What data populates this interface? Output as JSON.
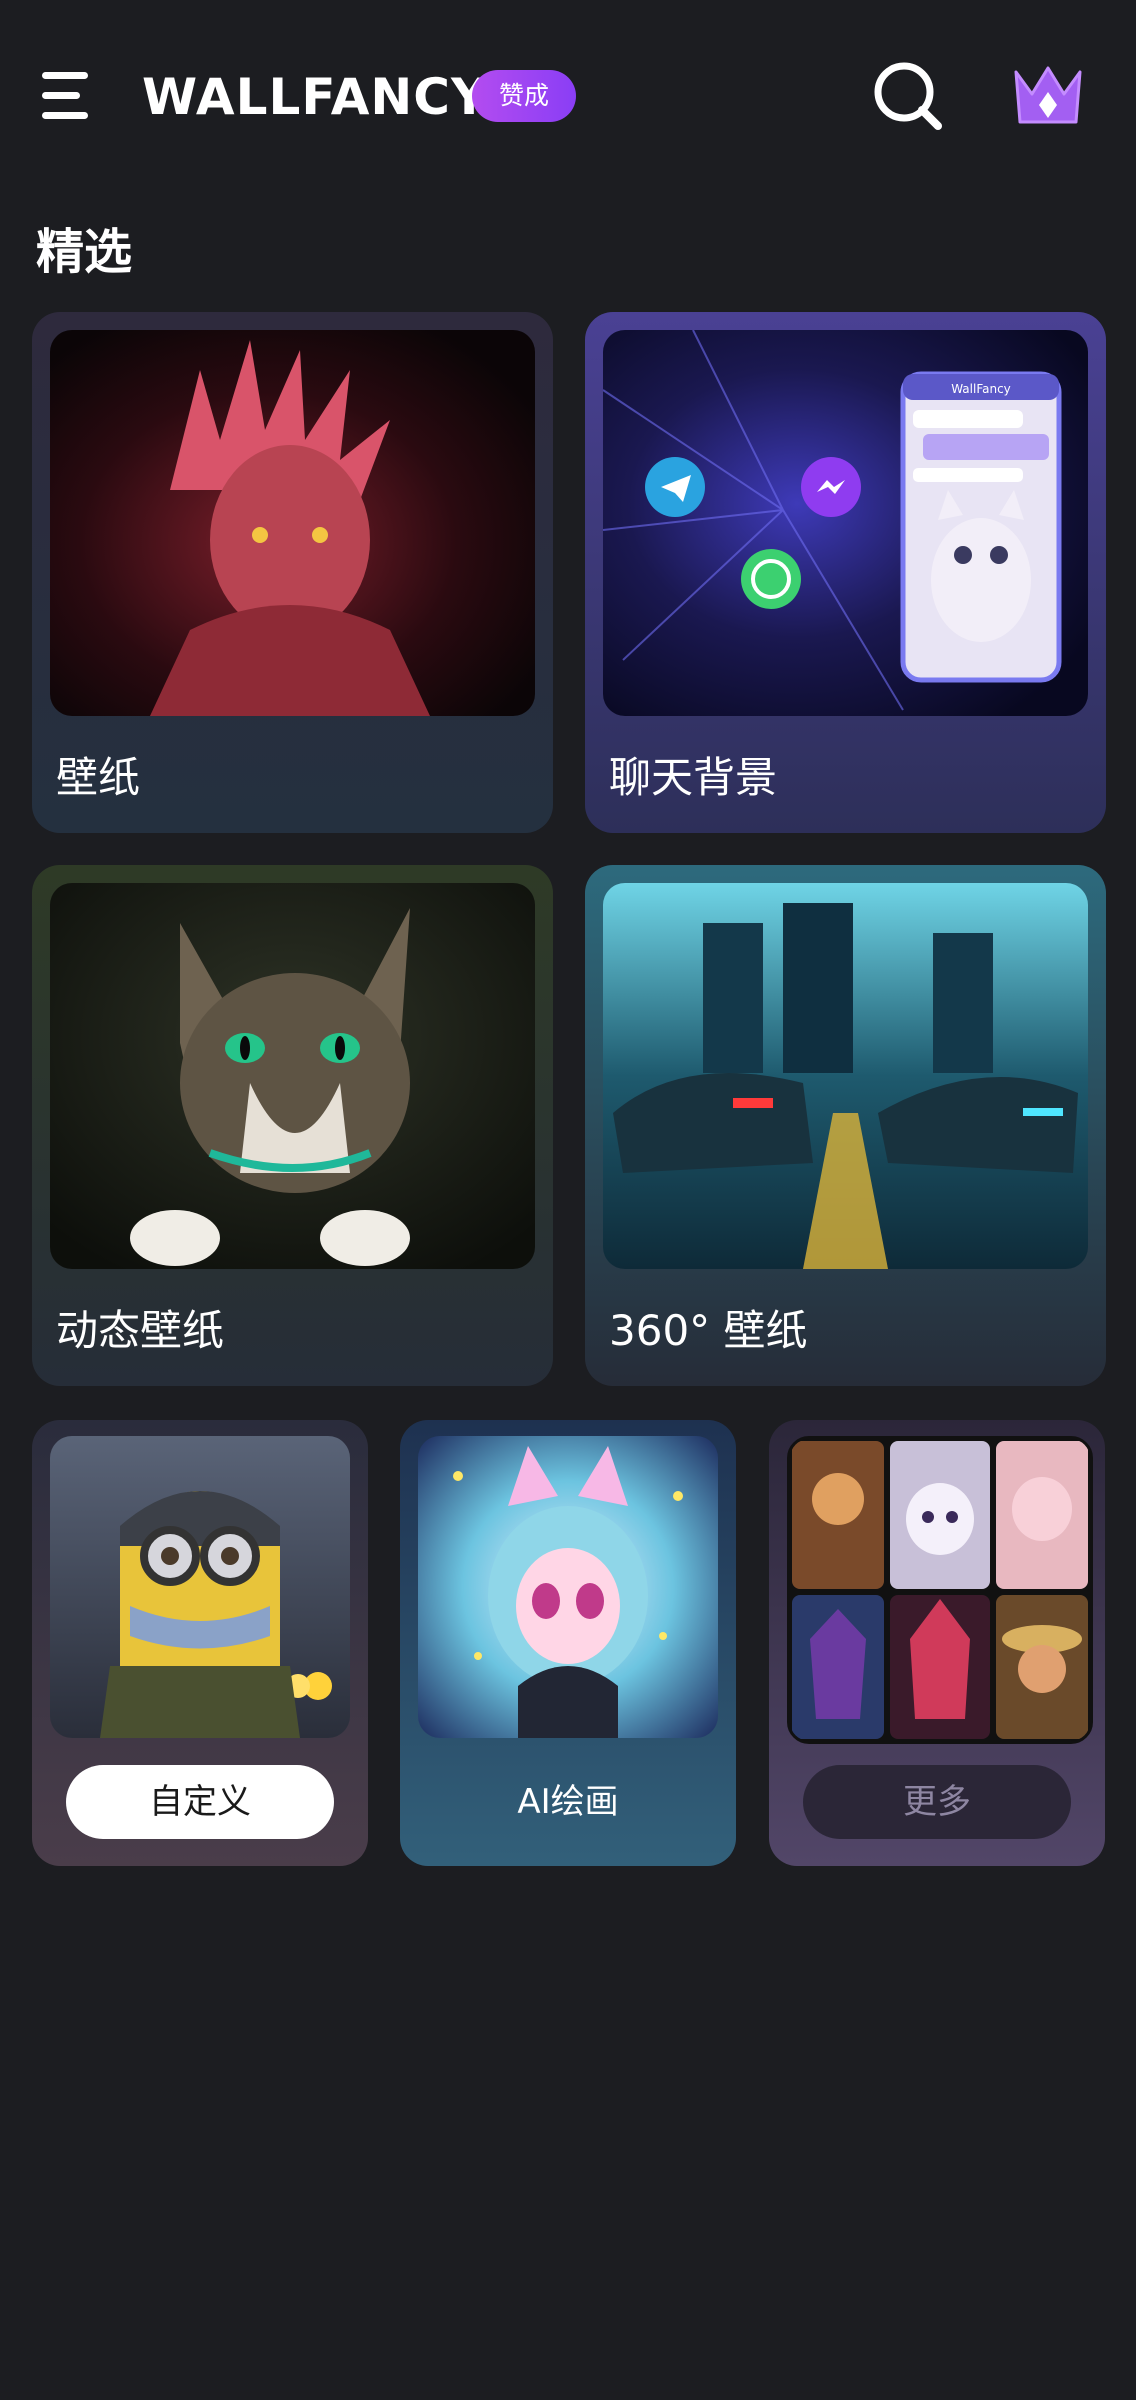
{
  "header": {
    "brand": "WALLFANCY",
    "badge": "赞成",
    "icons": [
      "menu-icon",
      "search-icon",
      "crown-icon"
    ]
  },
  "section": {
    "title": "精选"
  },
  "cards": {
    "wallpaper": {
      "label": "壁纸"
    },
    "chat_background": {
      "label": "聊天背景",
      "phone_title": "WallFancy"
    },
    "live_wallpaper": {
      "label": "动态壁纸"
    },
    "wallpaper_360": {
      "label": "360° 壁纸"
    },
    "custom": {
      "button": "自定义"
    },
    "ai_painting": {
      "label": "AI绘画"
    },
    "more": {
      "button": "更多"
    }
  },
  "colors": {
    "background": "#1c1d21",
    "accent_purple": "#9b4cf0",
    "crown": "#a35ff2"
  }
}
